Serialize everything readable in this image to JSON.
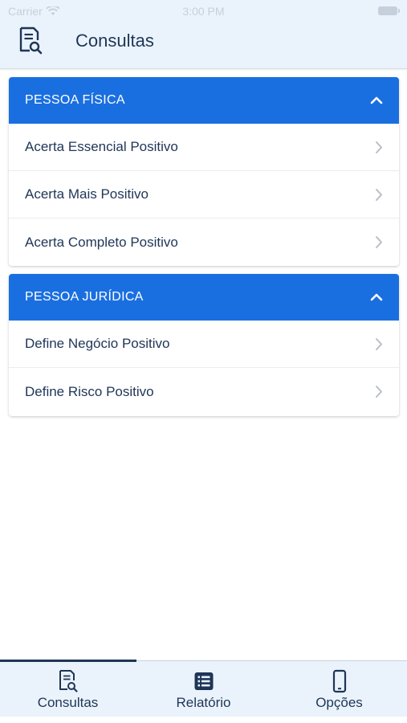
{
  "status_bar": {
    "carrier": "Carrier",
    "time": "3:00 PM"
  },
  "header": {
    "title": "Consultas"
  },
  "sections": [
    {
      "title": "PESSOA FÍSICA",
      "items": [
        {
          "label": "Acerta Essencial Positivo"
        },
        {
          "label": "Acerta Mais Positivo"
        },
        {
          "label": "Acerta Completo Positivo"
        }
      ]
    },
    {
      "title": "PESSOA JURÍDICA",
      "items": [
        {
          "label": "Define Negócio Positivo"
        },
        {
          "label": "Define Risco Positivo"
        }
      ]
    }
  ],
  "tabs": [
    {
      "label": "Consultas",
      "icon": "document-search-icon",
      "active": true
    },
    {
      "label": "Relatório",
      "icon": "list-icon",
      "active": false
    },
    {
      "label": "Opções",
      "icon": "phone-icon",
      "active": false
    }
  ],
  "colors": {
    "accent": "#1a6fe0",
    "text": "#1f3556",
    "header_bg": "#eaf3fb"
  }
}
